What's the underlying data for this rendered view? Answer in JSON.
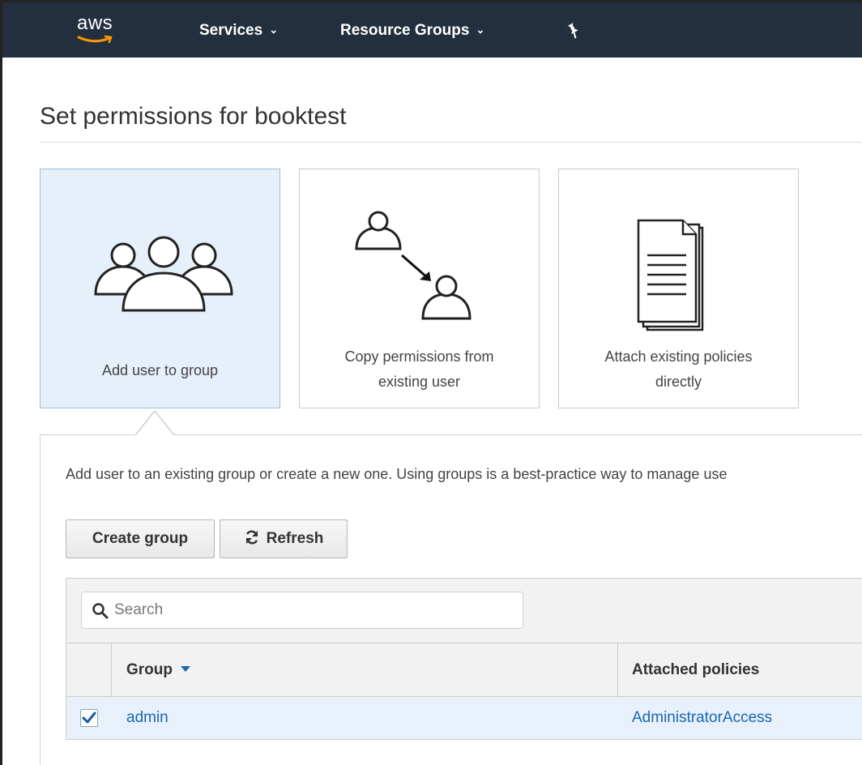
{
  "nav": {
    "logo_text": "aws",
    "services_label": "Services",
    "resource_groups_label": "Resource Groups"
  },
  "page": {
    "title": "Set permissions for booktest"
  },
  "options": [
    {
      "label": "Add user to group",
      "selected": true
    },
    {
      "label_line1": "Copy permissions from",
      "label_line2": "existing user",
      "selected": false
    },
    {
      "label_line1": "Attach existing policies",
      "label_line2": "directly",
      "selected": false
    }
  ],
  "panel": {
    "description": "Add user to an existing group or create a new one. Using groups is a best-practice way to manage use",
    "create_group_label": "Create group",
    "refresh_label": "Refresh"
  },
  "table": {
    "search_placeholder": "Search",
    "columns": [
      "Group",
      "Attached policies"
    ],
    "rows": [
      {
        "group": "admin",
        "attached_policies": "AdministratorAccess",
        "checked": true
      }
    ]
  },
  "colors": {
    "nav_bg": "#232f3e",
    "accent_orange": "#ff9900",
    "link_blue": "#1a66b3",
    "selected_bg": "#e6f0fb"
  }
}
